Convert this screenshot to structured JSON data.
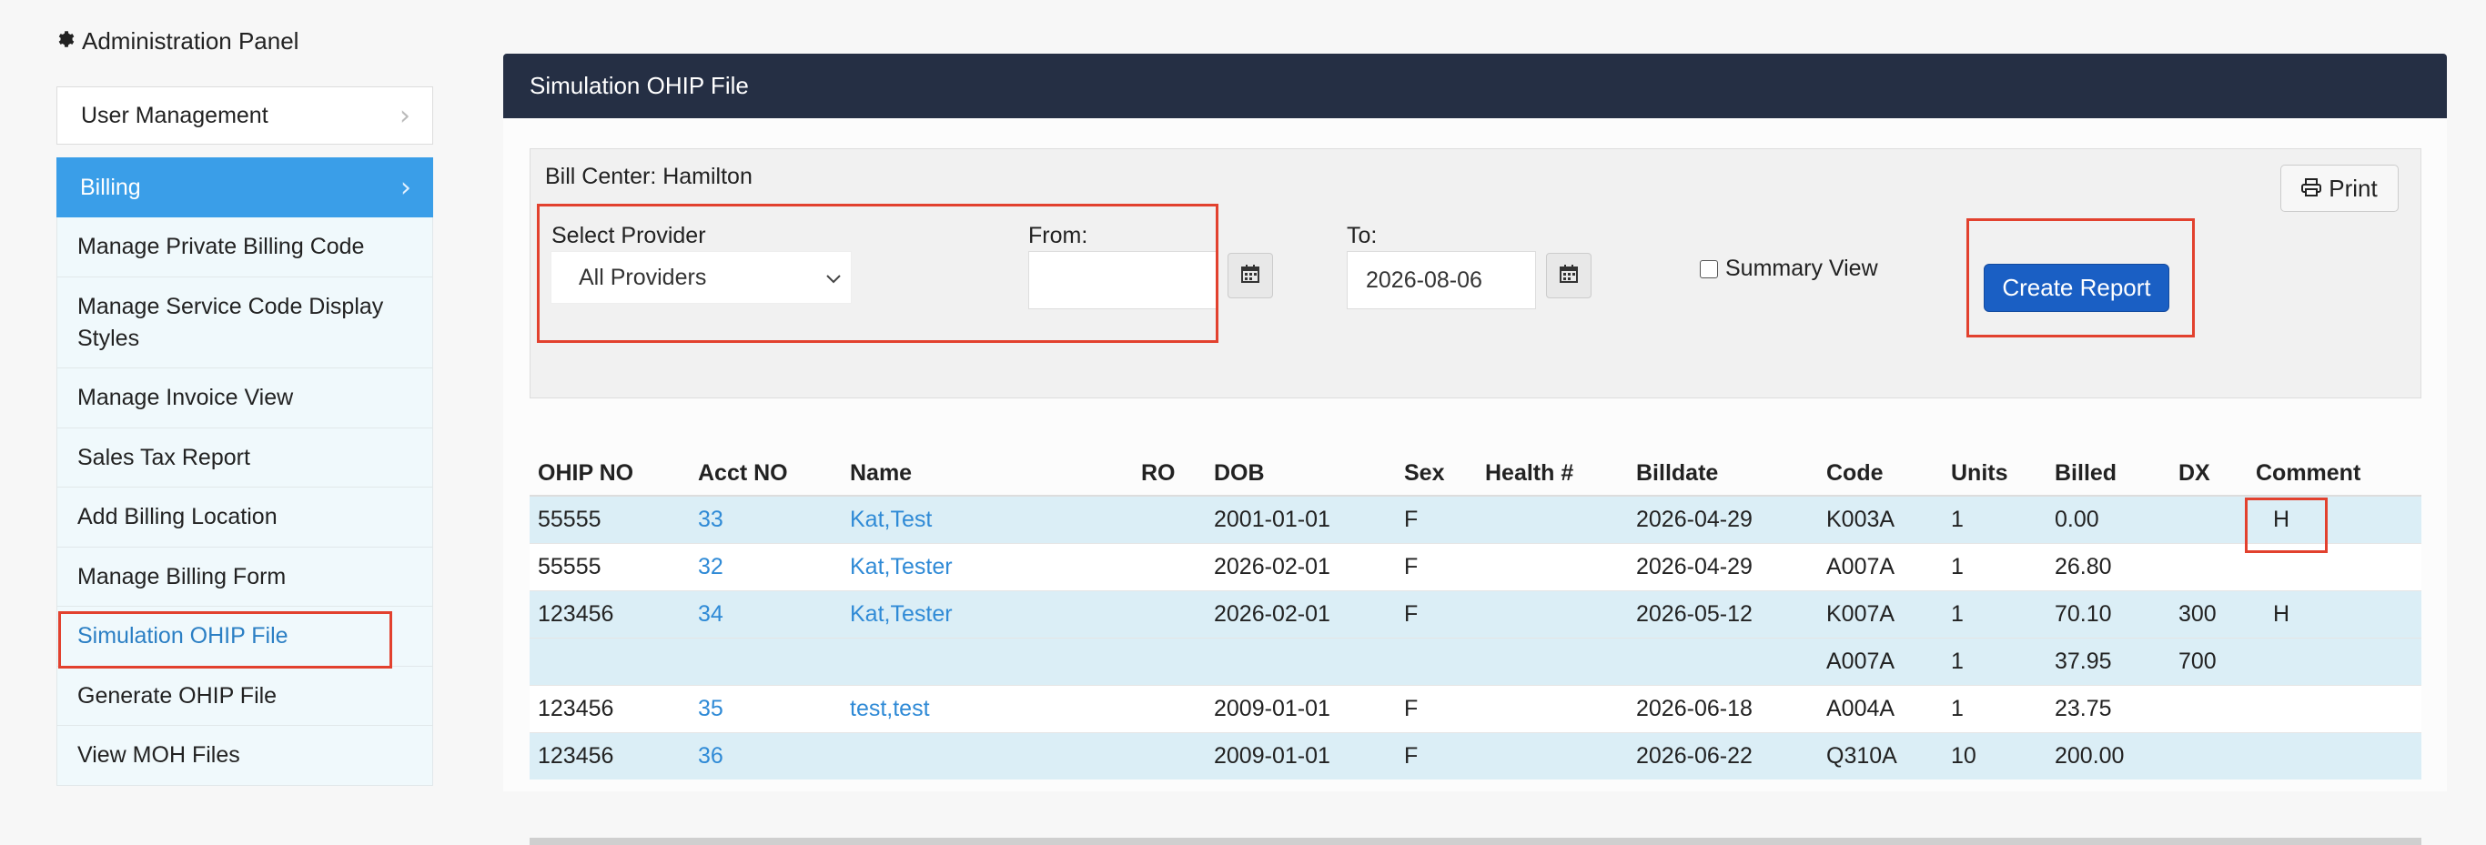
{
  "admin_panel": {
    "title": "Administration Panel",
    "icon": "gear-icon"
  },
  "sidebar": {
    "user_management": "User Management",
    "billing": "Billing",
    "items": [
      {
        "label": "Manage Private Billing Code"
      },
      {
        "label": "Manage Service Code Display Styles"
      },
      {
        "label": "Manage Invoice View"
      },
      {
        "label": "Sales Tax Report"
      },
      {
        "label": "Add Billing Location"
      },
      {
        "label": "Manage Billing Form"
      },
      {
        "label": "Simulation OHIP File"
      },
      {
        "label": "Generate OHIP File"
      },
      {
        "label": "View MOH Files"
      }
    ]
  },
  "header": {
    "title": "Simulation OHIP File"
  },
  "filters": {
    "bill_center": "Bill Center: Hamilton",
    "provider_label": "Select Provider",
    "provider_value": "All Providers",
    "from_label": "From:",
    "from_value": "",
    "to_label": "To:",
    "to_value": "2026-08-06",
    "summary_label": "Summary View",
    "summary_checked": false,
    "create_label": "Create Report",
    "print_label": "Print"
  },
  "colors": {
    "header_bg": "#252f44",
    "billing_active": "#3a9ee8",
    "primary_button": "#1a5fc4",
    "highlight": "#e2412e",
    "row_alt": "#dbeef6",
    "link": "#2f8ad6"
  },
  "table": {
    "columns": [
      "OHIP NO",
      "Acct NO",
      "Name",
      "RO",
      "DOB",
      "Sex",
      "Health #",
      "Billdate",
      "Code",
      "Units",
      "Billed",
      "DX",
      "Comment"
    ],
    "rows": [
      [
        "55555",
        "33",
        "Kat,Test",
        "",
        "2001-01-01",
        "F",
        "",
        "2026-04-29",
        "K003A",
        "1",
        "0.00",
        "",
        "H"
      ],
      [
        "55555",
        "32",
        "Kat,Tester",
        "",
        "2026-02-01",
        "F",
        "",
        "2026-04-29",
        "A007A",
        "1",
        "26.80",
        "",
        ""
      ],
      [
        "123456",
        "34",
        "Kat,Tester",
        "",
        "2026-02-01",
        "F",
        "",
        "2026-05-12",
        "K007A",
        "1",
        "70.10",
        "300",
        "H"
      ],
      [
        "",
        "",
        "",
        "",
        "",
        "",
        "",
        "",
        "A007A",
        "1",
        "37.95",
        "700",
        ""
      ],
      [
        "123456",
        "35",
        "test,test",
        "",
        "2009-01-01",
        "F",
        "",
        "2026-06-18",
        "A004A",
        "1",
        "23.75",
        "",
        ""
      ],
      [
        "123456",
        "36",
        "",
        "",
        "2009-01-01",
        "F",
        "",
        "2026-06-22",
        "Q310A",
        "10",
        "200.00",
        "",
        ""
      ]
    ]
  }
}
